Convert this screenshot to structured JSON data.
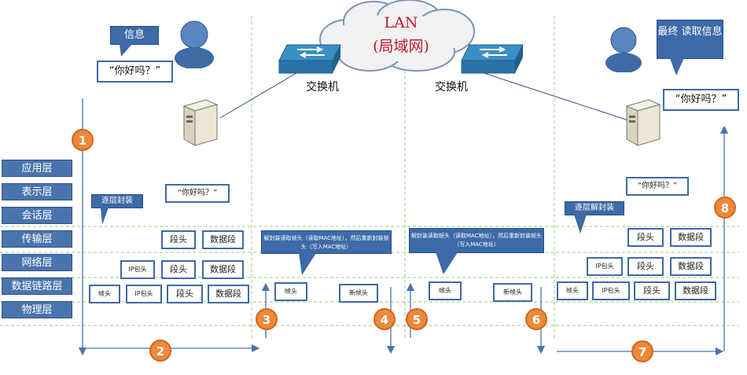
{
  "network": {
    "cloud_label_1": "LAN",
    "cloud_label_2": "(局域网)",
    "switch1_label": "交换机",
    "switch2_label": "交换机"
  },
  "layers": [
    "应用层",
    "表示层",
    "会话层",
    "传输层",
    "网络层",
    "数据链路层",
    "物理层"
  ],
  "left": {
    "callout_info": "信息",
    "message": "“你好吗？”",
    "encap_label": "逐层封装",
    "presentation_msg": "“你好吗？”",
    "transport": [
      "段头",
      "数据段"
    ],
    "network": [
      "IP包头",
      "段头",
      "数据段"
    ],
    "datalink": [
      "帧头",
      "IP包头",
      "段头",
      "数据段"
    ]
  },
  "switch_steps": {
    "callout1": "解封装读取帧头（读取MAC地址），然后重新封装帧头（写入MAC地址）",
    "callout2": "解封装读取帧头（读取MAC地址），然后重新封装帧头（写入MAC地址）",
    "frame1": "帧头",
    "newframe1": "新帧头",
    "frame2": "帧头",
    "newframe2": "新帧头"
  },
  "right": {
    "callout_final": "最终 读取信息",
    "message": "“你好吗？”",
    "decap_label": "逐层解封装",
    "presentation_msg": "“你好吗？”",
    "transport": [
      "段头",
      "数据段"
    ],
    "network": [
      "IP包头",
      "段头",
      "数据段"
    ],
    "datalink": [
      "帧头",
      "IP包头",
      "段头",
      "数据段"
    ]
  },
  "steps": [
    "1",
    "2",
    "3",
    "4",
    "5",
    "6",
    "7",
    "8"
  ],
  "colors": {
    "layer_fill": "#4a74ad",
    "box_border": "#3f6aa5",
    "step_circle": "#ea8a3a",
    "guide_line": "#9acd7a"
  }
}
